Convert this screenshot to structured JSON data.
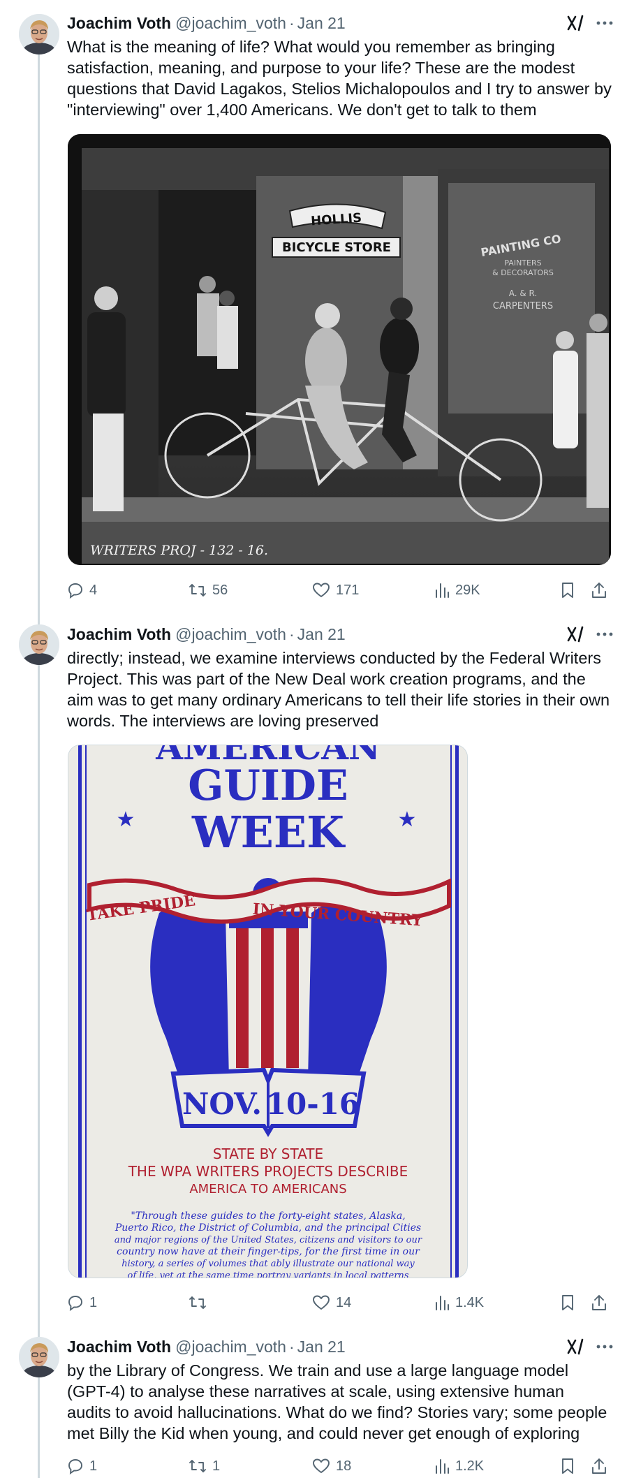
{
  "author": {
    "name": "Joachim Voth",
    "handle": "@joachim_voth",
    "separator": "·"
  },
  "colors": {
    "text": "#0f1419",
    "secondary": "#536471",
    "thread_line": "#cfd9de",
    "poster_blue": "#2a2ec0",
    "poster_red": "#b02030",
    "poster_bg": "#ecebe6"
  },
  "icons": {
    "reply": "reply-icon",
    "repost": "repost-icon",
    "like": "heart-icon",
    "views": "views-icon",
    "bookmark": "bookmark-icon",
    "share": "share-icon",
    "grok": "grok-icon",
    "more": "more-icon"
  },
  "tweets": [
    {
      "date": "Jan 21",
      "text": "What is the meaning of life? What would you remember as bringing satisfaction, meaning, and purpose to your life? These are the modest questions that David Lagakos, Stelios Michalopoulos and I try to answer by \"interviewing\" over 1,400 Americans. We don't get to talk to them",
      "photo": {
        "sign_top": "HOLLIS",
        "sign_bottom": "BICYCLE STORE",
        "shop_sign": "PAINTING CO",
        "shop_line1": "PAINTERS",
        "shop_line2": "& DECORATORS",
        "shop_line3": "A. & R.",
        "shop_line4": "CARPENTERS",
        "caption": "WRITERS PROJ - 132 - 16."
      },
      "replies": "4",
      "reposts": "56",
      "likes": "171",
      "views": "29K"
    },
    {
      "date": "Jan 21",
      "text": "directly; instead, we examine interviews conducted by the Federal Writers Project. This was part of the New Deal work creation programs, and the aim was to get many ordinary Americans to tell their life stories in their own words. The interviews are loving preserved",
      "poster": {
        "line1": "AMERICAN",
        "line2": "GUIDE",
        "line3": "WEEK",
        "banner_left": "TAKE PRIDE",
        "banner_right": "IN YOUR COUNTRY",
        "date_left": "NOV.",
        "date_right": "10-16",
        "sub1": "STATE BY STATE",
        "sub2": "THE WPA WRITERS PROJECTS DESCRIBE",
        "sub3": "AMERICA TO AMERICANS",
        "body": [
          "\"Through these guides to the forty-eight states, Alaska,",
          "Puerto Rico, the District of Columbia, and the principal Cities",
          "and major regions of the United States, citizens and visitors to our",
          "country now have at their finger-tips, for the first time in our",
          "history, a series of volumes that ably illustrate our national way",
          "of life, yet at the same time portray variants in local patterns"
        ]
      },
      "replies": "1",
      "reposts": "",
      "likes": "14",
      "views": "1.4K"
    },
    {
      "date": "Jan 21",
      "text": "by the Library of Congress. We train and use a large language model (GPT-4) to analyse these narratives at scale, using extensive human audits to avoid hallucinations. What do we find? Stories vary; some people met Billy the Kid when young, and could never get enough of exploring",
      "replies": "1",
      "reposts": "1",
      "likes": "18",
      "views": "1.2K"
    }
  ]
}
